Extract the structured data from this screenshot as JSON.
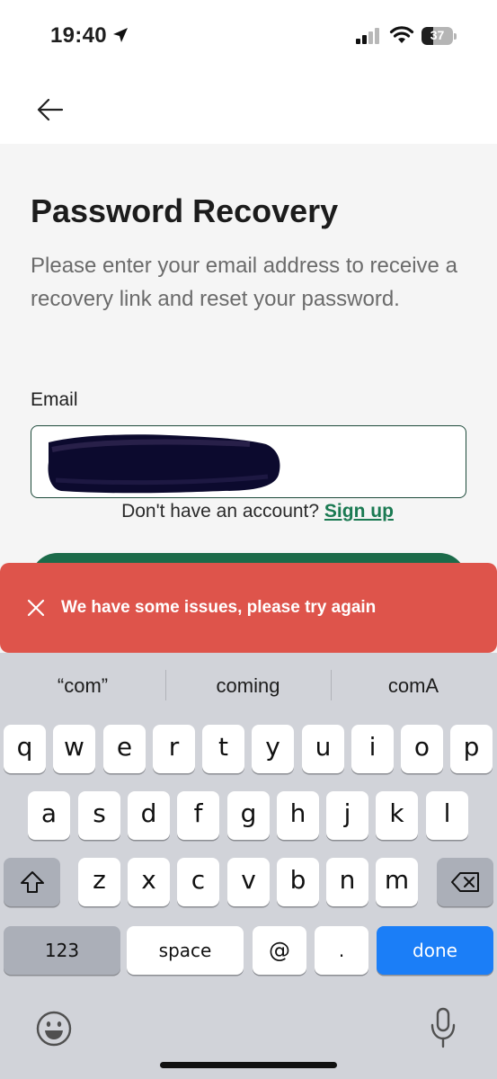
{
  "status_bar": {
    "time": "19:40",
    "battery": "37",
    "battery_level": 0.37
  },
  "page": {
    "title": "Password Recovery",
    "description": "Please enter your email address to receive a recovery link and reset your password.",
    "email_label": "Email",
    "email_value": "",
    "signup_prompt": "Don't have an account?",
    "signup_link": "Sign up"
  },
  "toast": {
    "message": "We have some issues, please try again",
    "color": "#de544b"
  },
  "keyboard": {
    "suggestions": [
      "“com”",
      "coming",
      "comA"
    ],
    "row1": [
      "q",
      "w",
      "e",
      "r",
      "t",
      "y",
      "u",
      "i",
      "o",
      "p"
    ],
    "row2": [
      "a",
      "s",
      "d",
      "f",
      "g",
      "h",
      "j",
      "k",
      "l"
    ],
    "row3": [
      "z",
      "x",
      "c",
      "v",
      "b",
      "n",
      "m"
    ],
    "numbers_label": "123",
    "space_label": "space",
    "at_label": "@",
    "dot_label": ".",
    "done_label": "done",
    "done_color": "#1b7ef7"
  },
  "colors": {
    "accent": "#1a7a52",
    "input_border": "#1d4a3a"
  }
}
